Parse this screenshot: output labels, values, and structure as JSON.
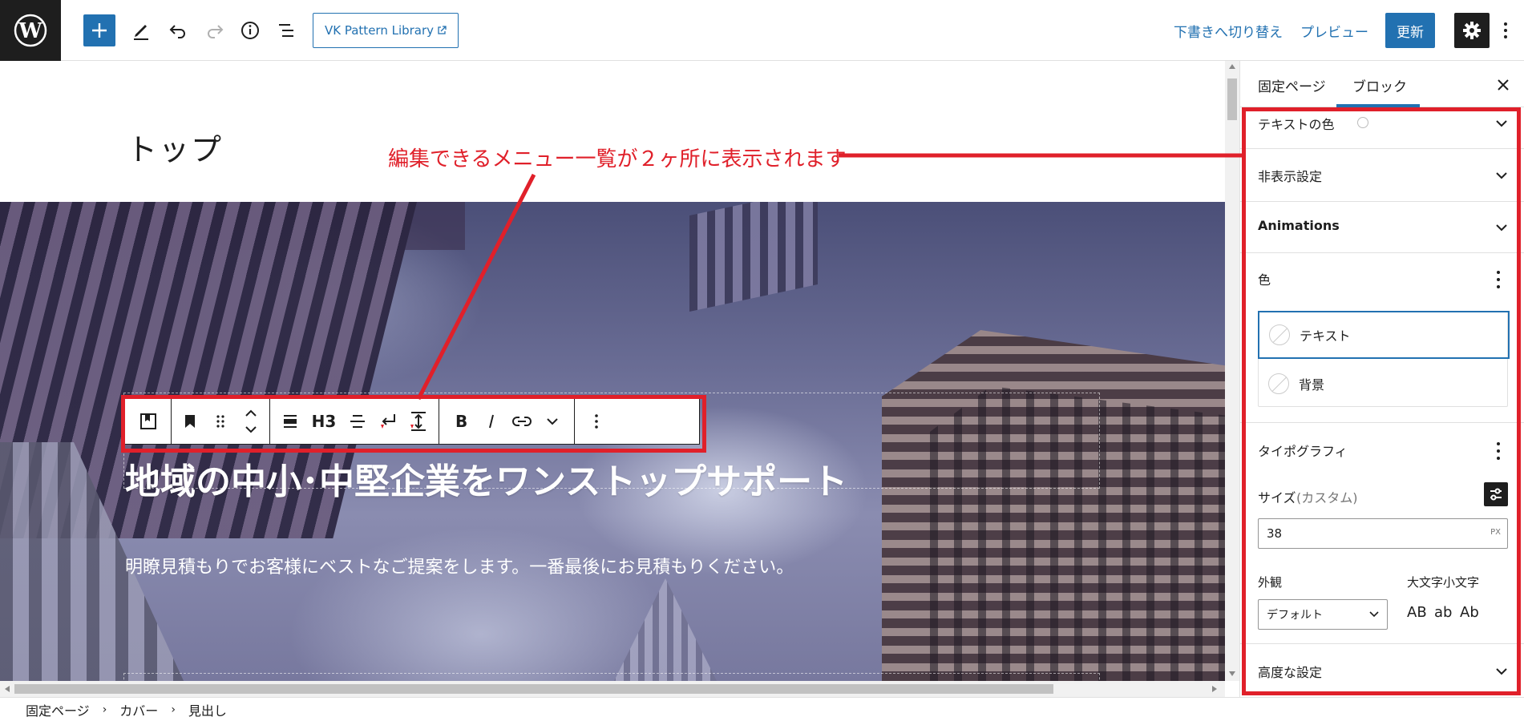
{
  "toolbar": {
    "vk_pattern_library": "VK Pattern Library",
    "switch_to_draft": "下書きへ切り替え",
    "preview": "プレビュー",
    "update": "更新"
  },
  "canvas": {
    "page_title": "トップ",
    "hero_heading": "地域の中小･中堅企業をワンストップサポート",
    "hero_text": "明瞭見積もりでお客様にベストなご提案をします。一番最後にお見積もりください。"
  },
  "block_toolbar": {
    "heading_level": "H3",
    "icons": [
      "bookmark-icon",
      "drag-handle-icon",
      "move-up-down-icon",
      "align-icon",
      "text-align-icon",
      "line-break-icon",
      "spacing-icon",
      "bold-icon",
      "italic-icon",
      "link-icon",
      "more-rich-text-icon",
      "options-icon"
    ]
  },
  "annotation": {
    "text": "編集できるメニュー一覧が２ヶ所に表示されます",
    "color": "#e0202a"
  },
  "sidebar": {
    "tabs": [
      {
        "label": "固定ページ",
        "active": false
      },
      {
        "label": "ブロック",
        "active": true
      }
    ],
    "text_color_label": "テキストの色",
    "hide_settings": "非表示設定",
    "animations": "Animations",
    "color_section": {
      "title": "色",
      "items": [
        "テキスト",
        "背景"
      ]
    },
    "typography": {
      "title": "タイポグラフィ",
      "size_label": "サイズ",
      "size_mode": "(カスタム)",
      "size_value": "38",
      "size_unit": "PX",
      "appearance_label": "外観",
      "appearance_value": "デフォルト",
      "case_label": "大文字小文字",
      "case_options": [
        "AB",
        "ab",
        "Ab"
      ]
    },
    "advanced": "高度な設定"
  },
  "breadcrumb": [
    "固定ページ",
    "カバー",
    "見出し"
  ],
  "colors": {
    "accent": "#2271b1",
    "dark": "#1e1e1e",
    "annotation_red": "#e0202a"
  }
}
